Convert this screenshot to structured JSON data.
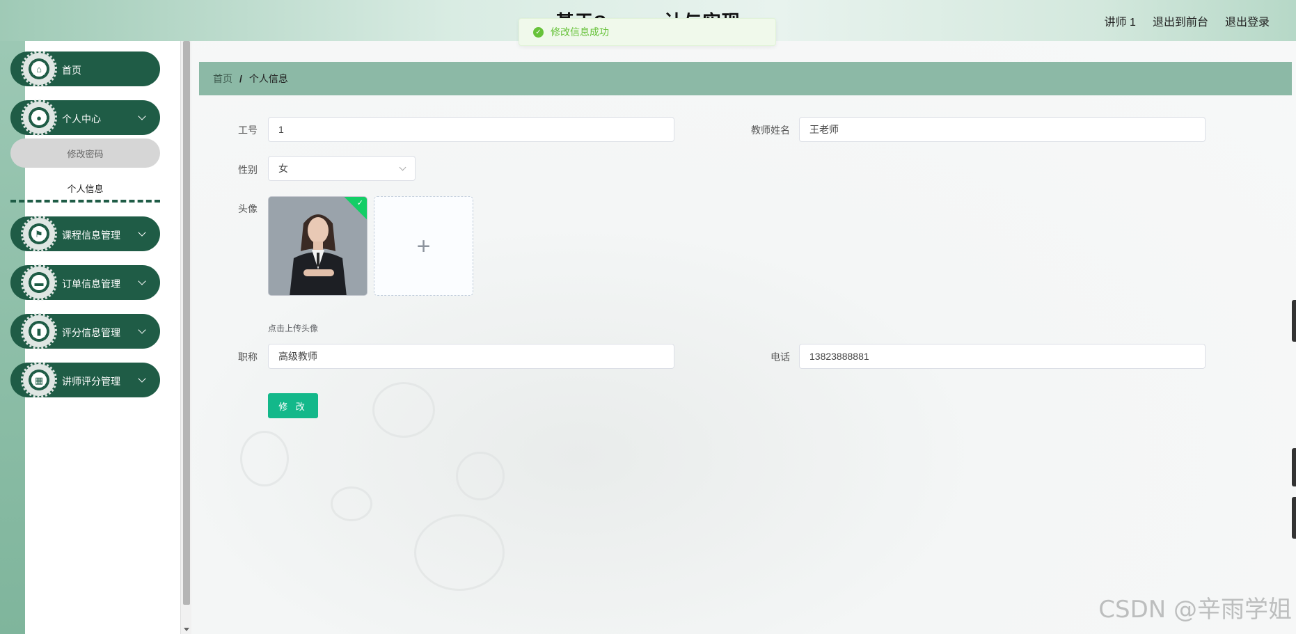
{
  "header": {
    "title": "基于Spr... ...计与实现",
    "user": "讲师 1",
    "back_front": "退出到前台",
    "logout": "退出登录"
  },
  "toast": {
    "message": "修改信息成功"
  },
  "sidebar": {
    "items": [
      {
        "label": "首页",
        "icon": "home-icon"
      },
      {
        "label": "个人中心",
        "icon": "user-icon"
      },
      {
        "label": "课程信息管理",
        "icon": "flag-icon"
      },
      {
        "label": "订单信息管理",
        "icon": "monitor-icon"
      },
      {
        "label": "评分信息管理",
        "icon": "bar-chart-icon"
      },
      {
        "label": "讲师评分管理",
        "icon": "grid-icon"
      }
    ],
    "submenu": {
      "change_password": "修改密码",
      "personal_info": "个人信息"
    }
  },
  "breadcrumb": {
    "home": "首页",
    "sep": "/",
    "current": "个人信息"
  },
  "form": {
    "id_label": "工号",
    "id_value": "1",
    "name_label": "教师姓名",
    "name_value": "王老师",
    "gender_label": "性别",
    "gender_value": "女",
    "avatar_label": "头像",
    "upload_tip": "点击上传头像",
    "title_label": "职称",
    "title_value": "高级教师",
    "phone_label": "电话",
    "phone_value": "13823888881",
    "submit": "修 改"
  },
  "watermark": "CSDN @辛雨学姐",
  "colors": {
    "primary": "#1f5c46",
    "button": "#13b88a",
    "breadcrumb_bg": "#8cb9a6",
    "success": "#67c23a"
  }
}
